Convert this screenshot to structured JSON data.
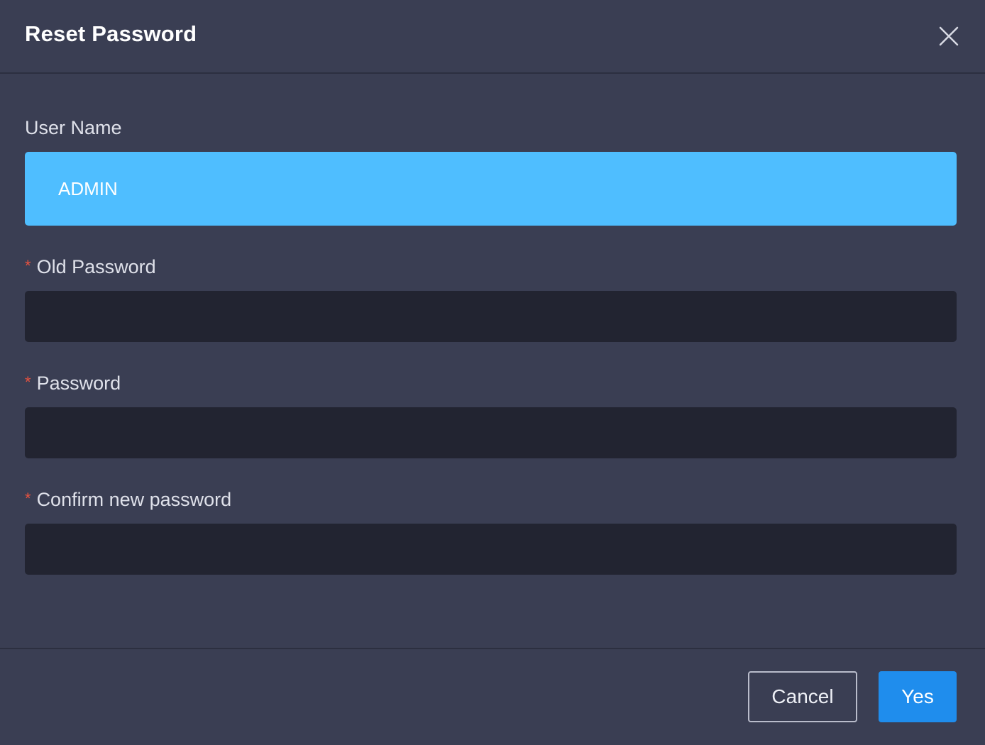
{
  "dialog": {
    "title": "Reset Password",
    "close_icon": "close-icon"
  },
  "form": {
    "username": {
      "label": "User Name",
      "value": "ADMIN"
    },
    "old_password": {
      "required_mark": "*",
      "label": "Old Password",
      "value": ""
    },
    "password": {
      "required_mark": "*",
      "label": "Password",
      "value": ""
    },
    "confirm_password": {
      "required_mark": "*",
      "label": "Confirm new password",
      "value": ""
    }
  },
  "footer": {
    "cancel_label": "Cancel",
    "yes_label": "Yes"
  },
  "colors": {
    "background": "#3a3e53",
    "input_dark": "#222431",
    "username_highlight": "#4fbeff",
    "primary": "#1f8ded",
    "required": "#e8523f"
  }
}
